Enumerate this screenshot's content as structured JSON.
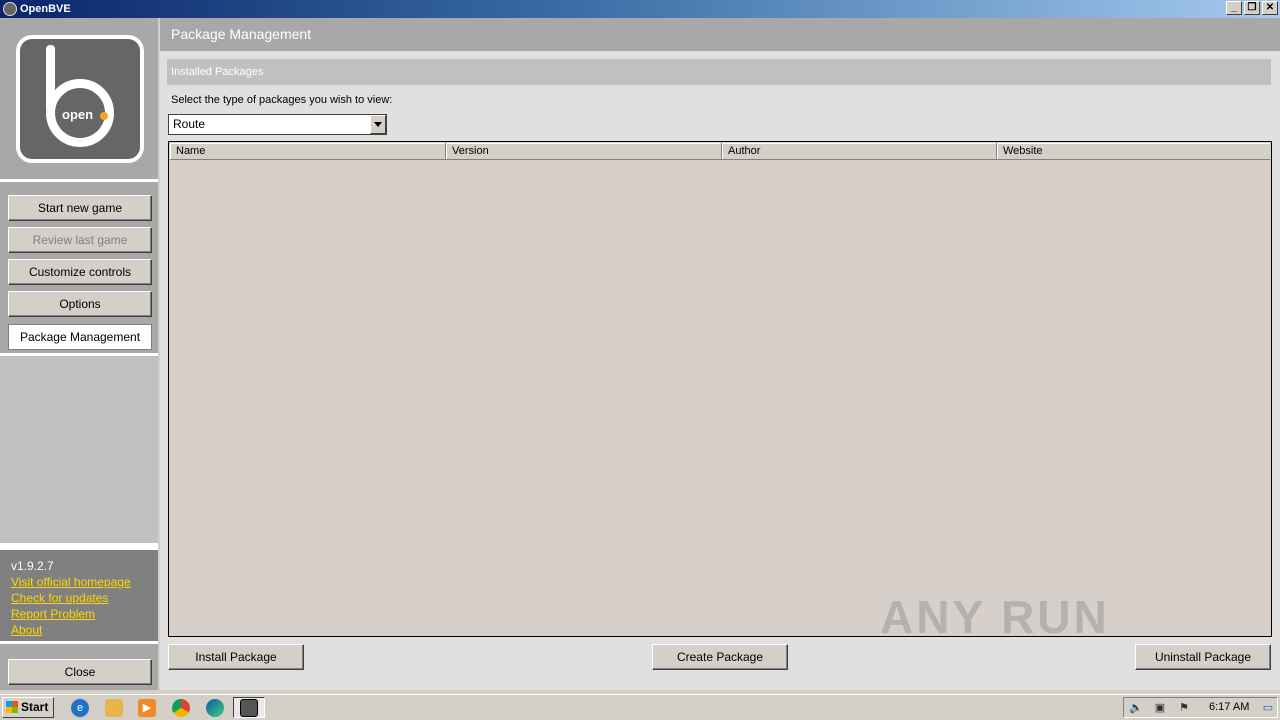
{
  "window": {
    "title": "OpenBVE",
    "controls": [
      "_",
      "❐",
      "✕"
    ]
  },
  "logo": {
    "text": "open"
  },
  "sidebar": {
    "nav": [
      {
        "label": "Start new game",
        "state": "normal"
      },
      {
        "label": "Review last game",
        "state": "disabled"
      },
      {
        "label": "Customize controls",
        "state": "normal"
      },
      {
        "label": "Options",
        "state": "normal"
      },
      {
        "label": "Package Management",
        "state": "active"
      }
    ],
    "version": "v1.9.2.7",
    "links": [
      "Visit official homepage",
      "Check for updates",
      "Report Problem",
      "About"
    ],
    "close_label": "Close"
  },
  "main": {
    "page_title": "Package Management",
    "section_title": "Installed Packages",
    "prompt": "Select the type of packages you wish to view:",
    "type_select": {
      "value": "Route"
    },
    "columns": [
      "Name",
      "Version",
      "Author",
      "Website"
    ],
    "buttons": {
      "install": "Install Package",
      "create": "Create Package",
      "uninstall": "Uninstall Package"
    }
  },
  "watermark": "ANY RUN",
  "taskbar": {
    "start_label": "Start",
    "apps": [
      "internet-explorer-icon",
      "file-explorer-icon",
      "media-player-icon",
      "chrome-icon",
      "edge-icon",
      "openbve-icon"
    ],
    "clock": "6:17 AM"
  }
}
